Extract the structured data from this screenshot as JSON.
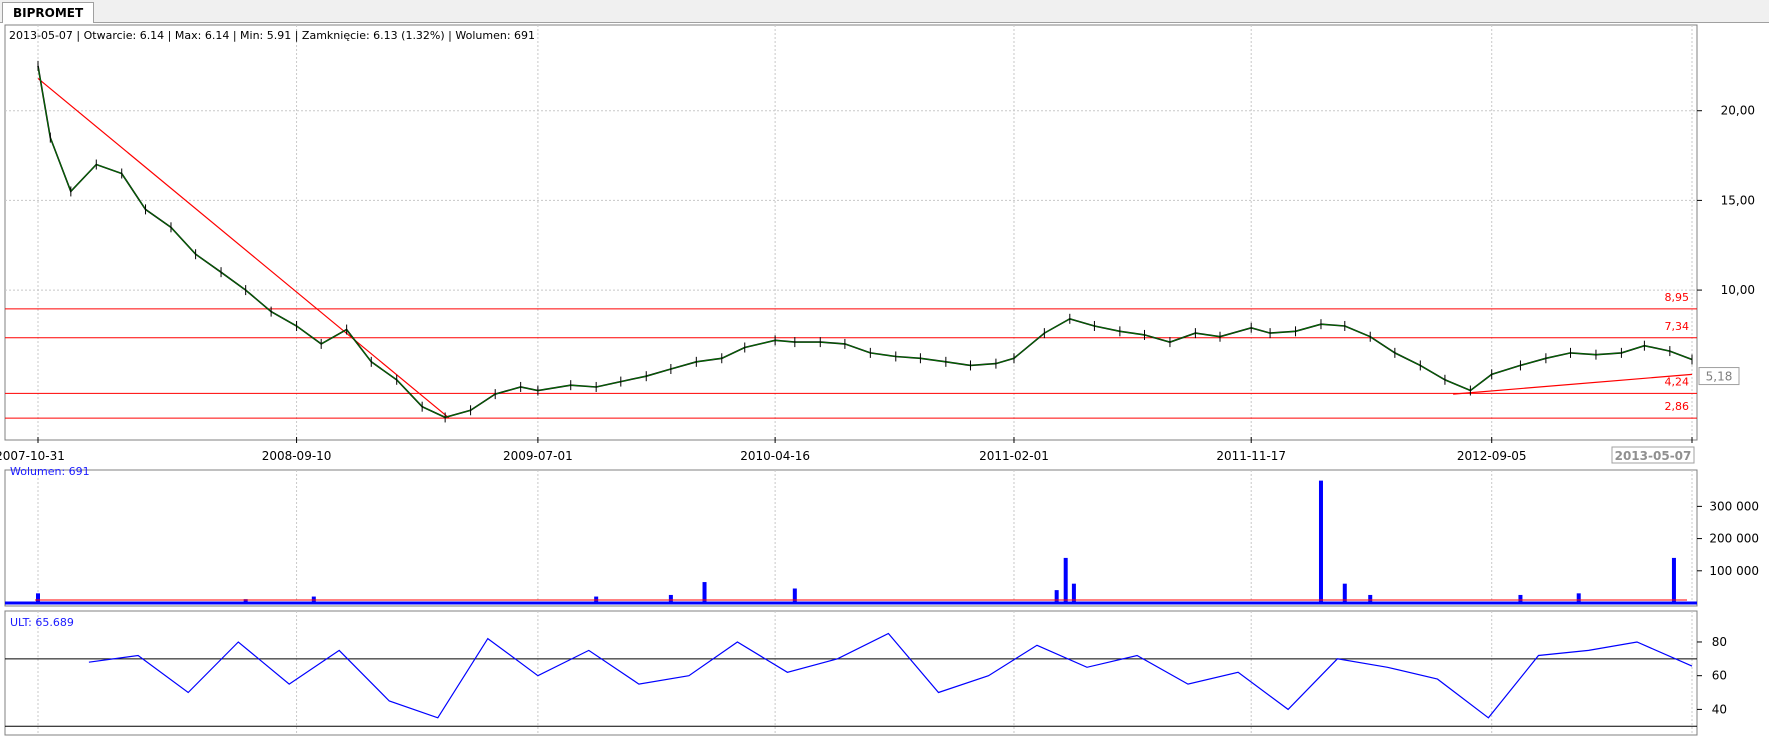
{
  "tab": {
    "label": "BIPROMET"
  },
  "info_line": "2013-05-07 | Otwarcie: 6.14 | Max: 6.14 | Min: 5.91 | Zamknięcie: 6.13 (1.32%)  | Wolumen: 691",
  "volume_label": "Wolumen: 691",
  "ult_label": "ULT: 65.689",
  "current_price_label": "5,18",
  "colors": {
    "candle": "#000000",
    "ma": "#008000",
    "lines": "#ff0000",
    "volume": "#0000ff",
    "ult": "#0000ff",
    "grid": "#c8c8c8"
  },
  "chart_data": [
    {
      "type": "line",
      "name": "price",
      "x_ticks": [
        "2007-10-31",
        "2008-09-10",
        "2009-07-01",
        "2010-04-16",
        "2011-02-01",
        "2011-11-17",
        "2012-09-05",
        "2013-05-07"
      ],
      "x_range": [
        "2007-10-31",
        "2013-05-07"
      ],
      "y_ticks": [
        "20,00",
        "15,00",
        "10,00"
      ],
      "ylim": [
        2.2,
        24.5
      ],
      "horizontal_levels": [
        {
          "label": "8,95",
          "value": 8.95
        },
        {
          "label": "7,34",
          "value": 7.34
        },
        {
          "label": "4,24",
          "value": 4.24
        },
        {
          "label": "2,86",
          "value": 2.86
        }
      ],
      "trendlines": [
        {
          "from": [
            "2007-10-31",
            21.8
          ],
          "to": [
            "2009-03-15",
            2.86
          ]
        },
        {
          "from": [
            "2012-07-20",
            4.2
          ],
          "to": [
            "2013-05-07",
            5.3
          ]
        }
      ],
      "x": [
        "2007-10-31",
        "2007-11-15",
        "2007-12-10",
        "2008-01-10",
        "2008-02-10",
        "2008-03-10",
        "2008-04-10",
        "2008-05-10",
        "2008-06-10",
        "2008-07-10",
        "2008-08-10",
        "2008-09-10",
        "2008-10-10",
        "2008-11-10",
        "2008-12-10",
        "2009-01-10",
        "2009-02-10",
        "2009-03-10",
        "2009-04-10",
        "2009-05-10",
        "2009-06-10",
        "2009-07-01",
        "2009-08-10",
        "2009-09-10",
        "2009-10-10",
        "2009-11-10",
        "2009-12-10",
        "2010-01-10",
        "2010-02-10",
        "2010-03-10",
        "2010-04-16",
        "2010-05-10",
        "2010-06-10",
        "2010-07-10",
        "2010-08-10",
        "2010-09-10",
        "2010-10-10",
        "2010-11-10",
        "2010-12-10",
        "2011-01-10",
        "2011-02-01",
        "2011-03-10",
        "2011-04-10",
        "2011-05-10",
        "2011-06-10",
        "2011-07-10",
        "2011-08-10",
        "2011-09-10",
        "2011-10-10",
        "2011-11-17",
        "2011-12-10",
        "2012-01-10",
        "2012-02-10",
        "2012-03-10",
        "2012-04-10",
        "2012-05-10",
        "2012-06-10",
        "2012-07-10",
        "2012-08-10",
        "2012-09-05",
        "2012-10-10",
        "2012-11-10",
        "2012-12-10",
        "2013-01-10",
        "2013-02-10",
        "2013-03-10",
        "2013-04-10",
        "2013-05-07"
      ],
      "values": [
        22.5,
        18.5,
        15.5,
        17.0,
        16.5,
        14.5,
        13.5,
        12.0,
        11.0,
        10.0,
        8.8,
        8.0,
        7.0,
        7.8,
        6.0,
        5.0,
        3.5,
        2.9,
        3.3,
        4.2,
        4.6,
        4.4,
        4.7,
        4.6,
        4.9,
        5.2,
        5.6,
        6.0,
        6.2,
        6.8,
        7.2,
        7.1,
        7.1,
        7.0,
        6.5,
        6.3,
        6.2,
        6.0,
        5.8,
        5.9,
        6.2,
        7.6,
        8.4,
        8.0,
        7.7,
        7.5,
        7.1,
        7.6,
        7.4,
        7.9,
        7.6,
        7.7,
        8.1,
        8.0,
        7.4,
        6.5,
        5.8,
        5.0,
        4.4,
        5.3,
        5.8,
        6.2,
        6.5,
        6.4,
        6.5,
        6.9,
        6.6,
        6.13
      ]
    },
    {
      "type": "bar",
      "name": "volume",
      "y_ticks": [
        "300 000",
        "200 000",
        "100 000"
      ],
      "ylim": [
        0,
        385000
      ],
      "x": [
        "2007-10-31",
        "2008-07-10",
        "2008-10-01",
        "2009-09-10",
        "2009-12-10",
        "2010-01-20",
        "2010-05-10",
        "2011-03-25",
        "2011-04-05",
        "2011-04-15",
        "2012-02-10",
        "2012-03-10",
        "2012-04-10",
        "2012-10-10",
        "2012-12-20",
        "2013-04-15",
        "2013-05-07"
      ],
      "values": [
        30000,
        12000,
        20000,
        20000,
        25000,
        65000,
        45000,
        40000,
        140000,
        60000,
        380000,
        60000,
        25000,
        25000,
        30000,
        140000,
        691
      ]
    },
    {
      "type": "line",
      "name": "ULT",
      "y_ticks": [
        "80",
        "60",
        "40"
      ],
      "ylim": [
        26,
        96
      ],
      "reference_levels": [
        70,
        30
      ],
      "x": [
        "2008-01-01",
        "2008-03-01",
        "2008-05-01",
        "2008-07-01",
        "2008-09-01",
        "2008-11-01",
        "2009-01-01",
        "2009-03-01",
        "2009-05-01",
        "2009-07-01",
        "2009-09-01",
        "2009-11-01",
        "2010-01-01",
        "2010-03-01",
        "2010-05-01",
        "2010-07-01",
        "2010-09-01",
        "2010-11-01",
        "2011-01-01",
        "2011-03-01",
        "2011-05-01",
        "2011-07-01",
        "2011-09-01",
        "2011-11-01",
        "2012-01-01",
        "2012-03-01",
        "2012-05-01",
        "2012-07-01",
        "2012-09-01",
        "2012-11-01",
        "2013-01-01",
        "2013-03-01",
        "2013-05-07"
      ],
      "values": [
        68,
        72,
        50,
        80,
        55,
        75,
        45,
        35,
        82,
        60,
        75,
        55,
        60,
        80,
        62,
        70,
        85,
        50,
        60,
        78,
        65,
        72,
        55,
        62,
        40,
        70,
        65,
        58,
        35,
        72,
        75,
        80,
        65.689
      ]
    }
  ]
}
